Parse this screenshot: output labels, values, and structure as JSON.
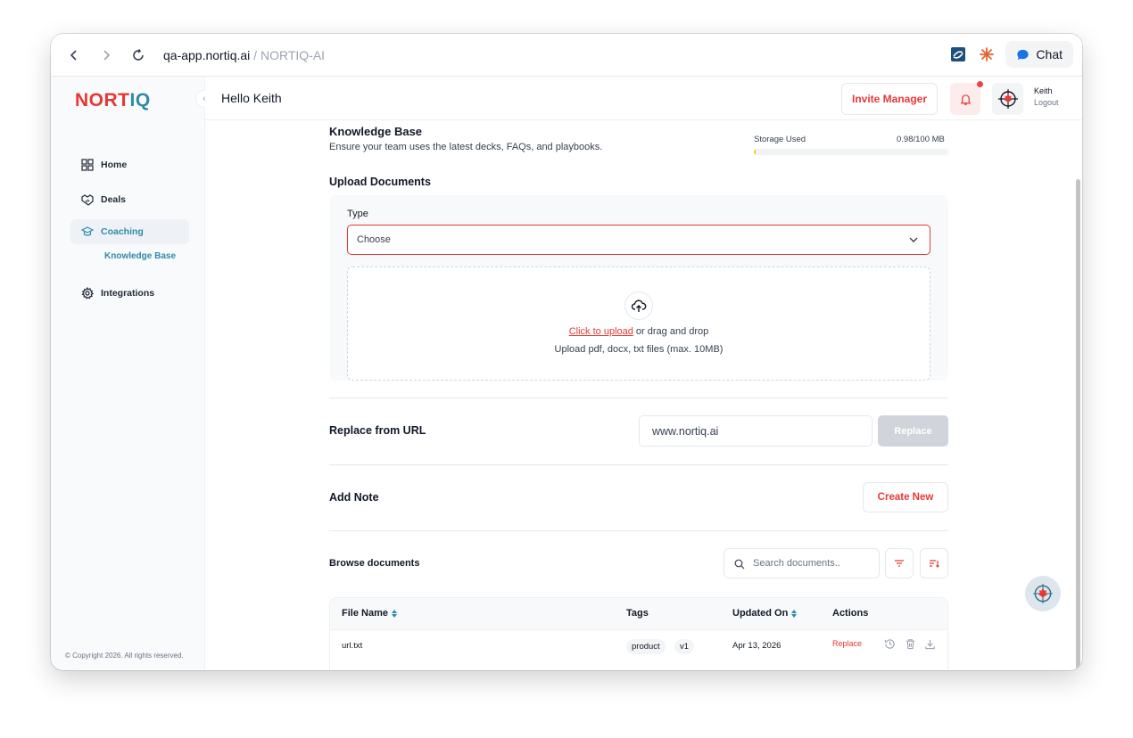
{
  "browser": {
    "url_host": "qa-app.nortiq.ai",
    "url_sep": " / ",
    "url_title": "NORTIQ-AI",
    "chat_label": "Chat"
  },
  "sidebar": {
    "logo": {
      "n": "N",
      "o": "O",
      "rt": "RT",
      "iq": "IQ"
    },
    "collapse_glyph": "‹",
    "items": [
      {
        "label": "Home",
        "icon": "grid-icon"
      },
      {
        "label": "Deals",
        "icon": "handshake-icon"
      },
      {
        "label": "Coaching",
        "icon": "graduation-cap-icon",
        "active": true
      },
      {
        "label": "Integrations",
        "icon": "gear-icon"
      }
    ],
    "sub_item": "Knowledge Base",
    "copyright": "© Copyright 2026. All rights reserved."
  },
  "header": {
    "greeting": "Hello Keith",
    "invite_label": "Invite Manager",
    "user_name": "Keith",
    "logout_label": "Logout"
  },
  "knowledge_base": {
    "title": "Knowledge Base",
    "subtitle": "Ensure your team uses the latest decks, FAQs, and playbooks.",
    "storage_label": "Storage Used",
    "storage_value": "0.98/100 MB",
    "storage_fraction": 0.0098
  },
  "upload": {
    "title": "Upload Documents",
    "type_label": "Type",
    "type_placeholder": "Choose",
    "click_to_upload": "Click to upload",
    "drag_text": " or drag and drop",
    "hint": "Upload pdf, docx, txt files (max. 10MB)"
  },
  "replace_url": {
    "title": "Replace from URL",
    "value": "www.nortiq.ai",
    "button": "Replace"
  },
  "note": {
    "title": "Add Note",
    "button": "Create New"
  },
  "browse": {
    "title": "Browse documents",
    "search_placeholder": "Search documents.."
  },
  "table": {
    "columns": [
      "File Name",
      "Tags",
      "Updated On",
      "Actions"
    ],
    "rows": [
      {
        "file": "url.txt",
        "tags": [
          "product",
          "v1"
        ],
        "updated": "Apr 13, 2026",
        "action": "Replace"
      }
    ]
  },
  "colors": {
    "accent": "#e53935",
    "brand_teal": "#2f8aa8",
    "storage_fill": "#facc15"
  }
}
